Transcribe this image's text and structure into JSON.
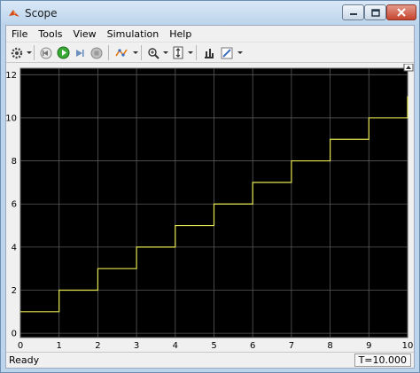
{
  "window": {
    "title": "Scope"
  },
  "menu": [
    "File",
    "Tools",
    "View",
    "Simulation",
    "Help"
  ],
  "toolbar": {
    "icons": [
      "settings-icon",
      "step-back-icon",
      "run-icon",
      "step-forward-icon",
      "stop-icon",
      "highlight-signal-icon",
      "zoom-icon",
      "autoscale-icon",
      "measure-icon",
      "style-icon"
    ]
  },
  "status": {
    "left": "Ready",
    "right": "T=10.000"
  },
  "colors": {
    "plot_bg": "#000000",
    "signal": "#e6e650",
    "grid": "#5a5a5a",
    "axis_text": "#d0d0d0"
  },
  "chart_data": {
    "type": "line",
    "xlim": [
      0,
      10
    ],
    "ylim": [
      -0.2,
      12.3
    ],
    "xticks": [
      "0",
      "1",
      "2",
      "3",
      "4",
      "5",
      "6",
      "7",
      "8",
      "9",
      "10"
    ],
    "yticks": [
      "0",
      "2",
      "4",
      "6",
      "8",
      "10",
      "12"
    ],
    "grid": true,
    "series": [
      {
        "x": [
          0,
          1,
          1,
          2,
          2,
          3,
          3,
          4,
          4,
          5,
          5,
          6,
          6,
          7,
          7,
          8,
          8,
          9,
          9,
          10,
          10
        ],
        "y": [
          1,
          1,
          2,
          2,
          3,
          3,
          4,
          4,
          5,
          5,
          6,
          6,
          7,
          7,
          8,
          8,
          9,
          9,
          10,
          10,
          11
        ]
      }
    ]
  }
}
